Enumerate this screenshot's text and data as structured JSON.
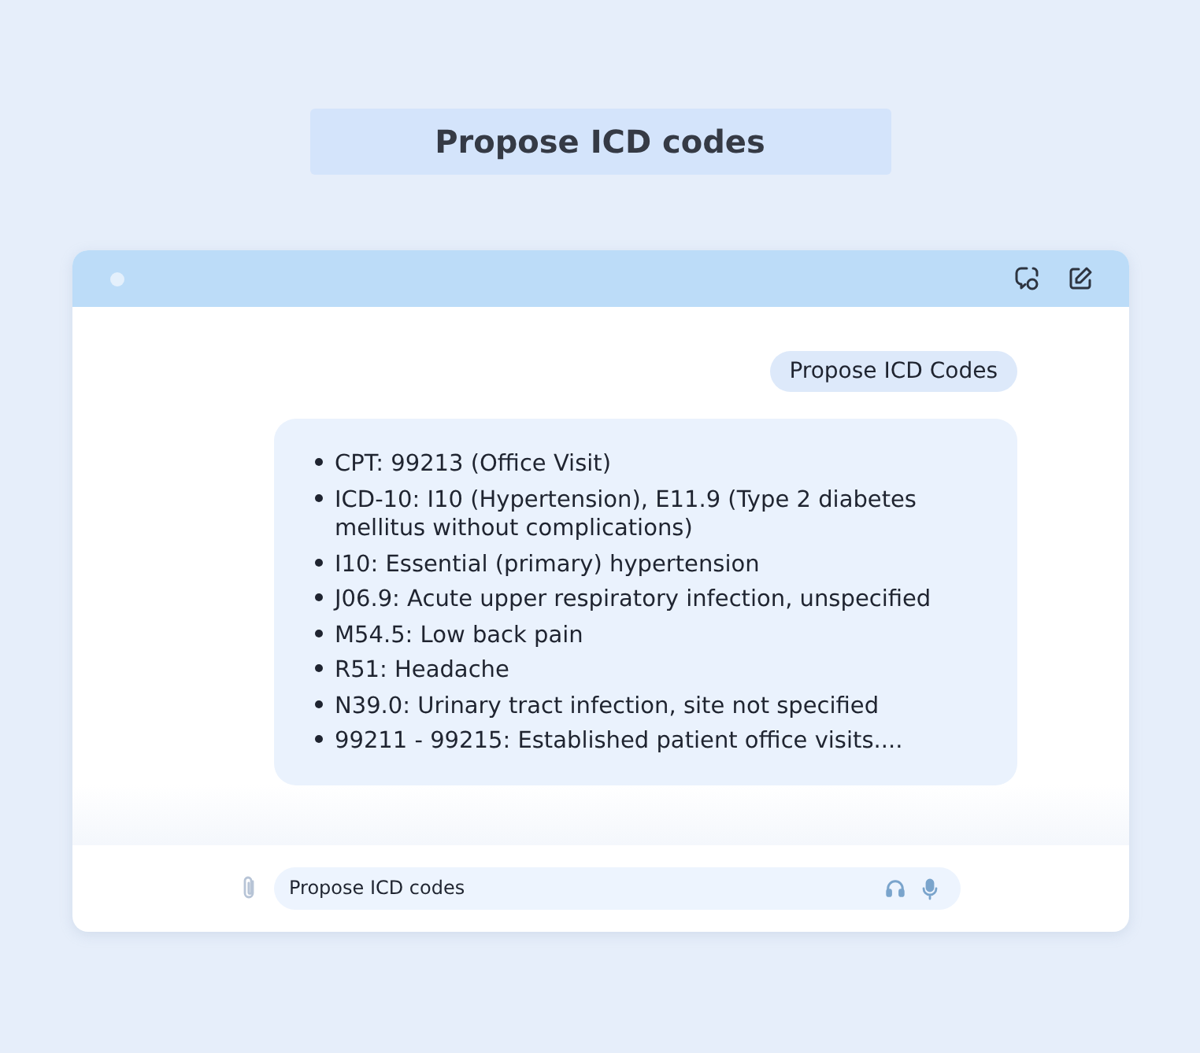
{
  "page_title": "Propose ICD codes",
  "chat": {
    "user_message": "Propose ICD Codes",
    "response_items": [
      "CPT: 99213 (Office Visit)",
      "ICD-10: I10 (Hypertension), E11.9 (Type 2 diabetes mellitus without complications)",
      "I10: Essential (primary) hypertension",
      "J06.9: Acute upper respiratory infection, unspecified",
      "M54.5: Low back pain",
      "R51: Headache",
      "N39.0: Urinary tract infection, site not specified",
      "99211 - 99215: Established patient office visits...."
    ]
  },
  "input": {
    "value": "Propose ICD codes"
  }
}
